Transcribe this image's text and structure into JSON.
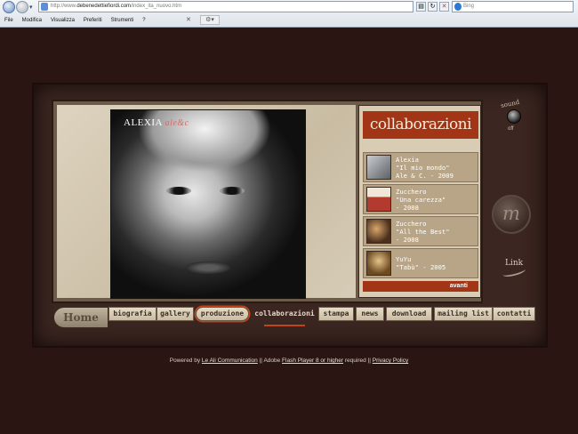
{
  "browser": {
    "url_prefix": "http://www.",
    "url_domain": "debenedettiefiordi.com",
    "url_path": "/index_ita_nuovo.htm",
    "search_placeholder": "Bing",
    "menu": [
      "File",
      "Modifica",
      "Visualizza",
      "Preferiti",
      "Strumenti",
      "?"
    ]
  },
  "photo": {
    "title_main": "ALEXIA",
    "title_accent": "ale&c"
  },
  "panel": {
    "title": "collaborazioni",
    "items": [
      {
        "text": "Alexia\n\"Il mio mondo\"\nAle & C. - 2009",
        "thumb_color": "#8a8f95"
      },
      {
        "text": "Zucchero\n\"Una carezza\"\n- 2008",
        "thumb_color": "#b23a2e"
      },
      {
        "text": "Zucchero\n\"All the Best\"\n- 2008",
        "thumb_color": "#6d4a2e"
      },
      {
        "text": "YuYu\n\"Tabù\" - 2005",
        "thumb_color": "#8b6a3c"
      }
    ],
    "next_label": "avanti"
  },
  "controls": {
    "sound_label": "sound",
    "sound_state": "off",
    "m_label": "m",
    "link_label": "Link"
  },
  "nav": {
    "home": "Home",
    "tabs": [
      "biografia",
      "gallery",
      "produzione",
      "collaborazioni",
      "stampa",
      "news",
      "download",
      "mailing list",
      "contatti"
    ],
    "active_tab": "collaborazioni",
    "circled_tab": "produzione"
  },
  "footer": {
    "powered_by": "Powered by",
    "company": "Le Ali Communication",
    "separator1": "||",
    "adobe": "Adobe",
    "flash_link": "Flash Player 8 or higher",
    "required": "required",
    "separator2": "||",
    "privacy": "Privacy Policy"
  },
  "colors": {
    "background": "#2a1512",
    "accent": "#a23516",
    "panel": "#d8ccb4"
  }
}
